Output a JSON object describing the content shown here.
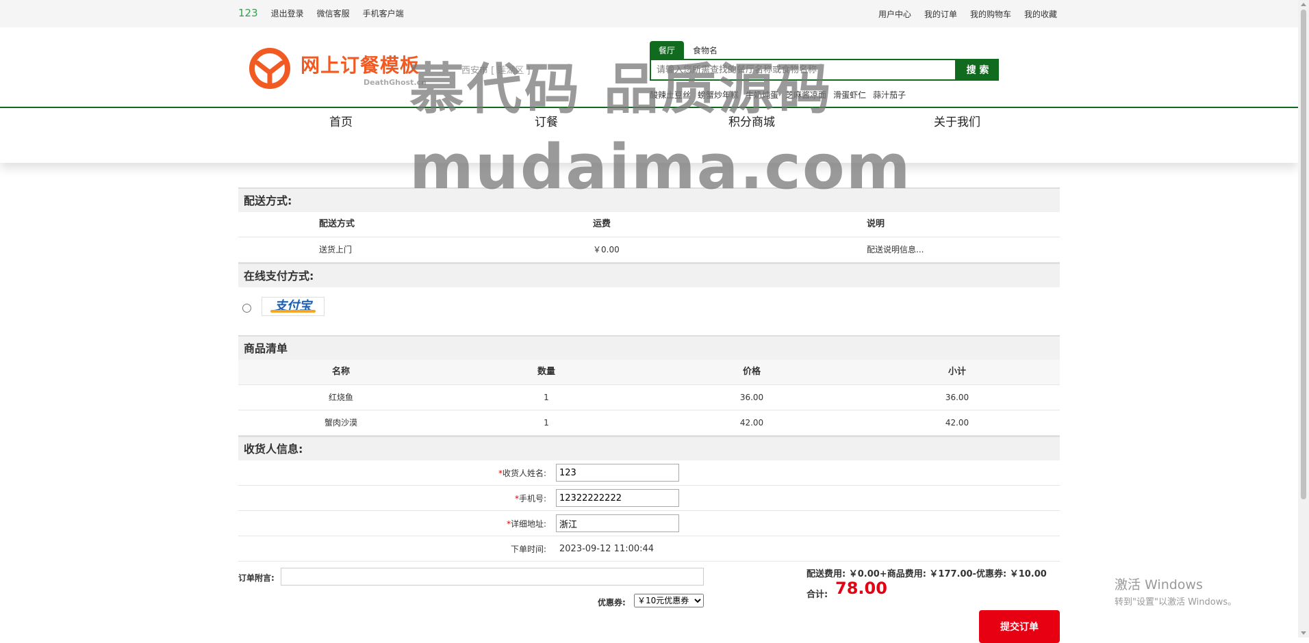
{
  "topbar": {
    "username": "123",
    "left_links": [
      "退出登录",
      "微信客服",
      "手机客户端"
    ],
    "right_links": [
      "用户中心",
      "我的订单",
      "我的购物车",
      "我的收藏"
    ]
  },
  "header": {
    "brand": "网上订餐模板",
    "brand_sub": "DeathGhost.cn",
    "city": "西安市",
    "district": "莲湖区",
    "search_tabs": [
      "餐厅",
      "食物名"
    ],
    "search_placeholder": "请输入您所需查找的餐厅名称或食物名称",
    "search_button": "搜 索",
    "hot_words": [
      "酸辣土豆丝",
      "螃蟹炒年糕",
      "牛奶炖蛋",
      "芝麻酱凉面",
      "滑蛋虾仁",
      "蒜汁茄子"
    ]
  },
  "nav": {
    "items": [
      "首页",
      "订餐",
      "积分商城",
      "关于我们"
    ]
  },
  "watermark": {
    "line1": "慕代码 品质源码",
    "line2": "mudaima.com"
  },
  "delivery": {
    "title": "配送方式:",
    "headers": [
      "配送方式",
      "运费",
      "说明"
    ],
    "row": [
      "送货上门",
      "￥0.00",
      "配送说明信息..."
    ]
  },
  "payment": {
    "title": "在线支付方式:",
    "option": "支付宝"
  },
  "goods": {
    "title": "商品清单",
    "headers": [
      "名称",
      "数量",
      "价格",
      "小计"
    ],
    "rows": [
      [
        "红烧鱼",
        "1",
        "36.00",
        "36.00"
      ],
      [
        "蟹肉沙漠",
        "1",
        "42.00",
        "42.00"
      ]
    ]
  },
  "receiver": {
    "title": "收货人信息:",
    "name_label": "收货人姓名:",
    "name_value": "123",
    "phone_label": "手机号:",
    "phone_value": "12322222222",
    "address_label": "详细地址:",
    "address_value": "浙江",
    "time_label": "下单时间:",
    "time_value": "2023-09-12 11:00:44",
    "required_mark": "*"
  },
  "order": {
    "note_label": "订单附言:",
    "coupon_label": "优惠券:",
    "coupon_value": "￥10元优惠券",
    "fees": "配送费用: ￥0.00+商品费用: ￥177.00-优惠券: ￥10.00",
    "total_label": "合计:",
    "total_value": "78.00",
    "submit": "提交订单"
  },
  "windows": {
    "line1": "激活 Windows",
    "line2": "转到\"设置\"以激活 Windows。"
  },
  "colors": {
    "brand_green": "#116b1e",
    "brand_orange": "#f15a22",
    "accent_red": "#e60012"
  }
}
